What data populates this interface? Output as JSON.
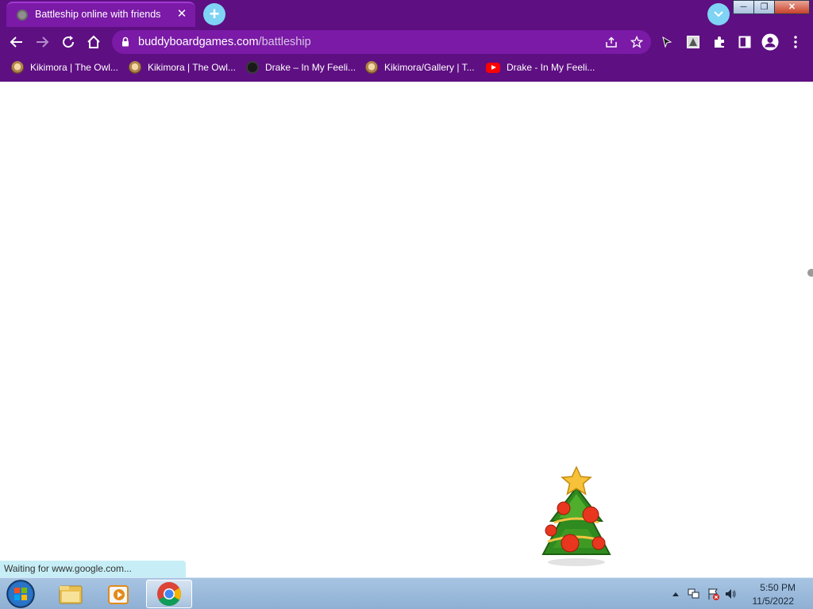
{
  "tab": {
    "title": "Battleship online with friends",
    "close_glyph": "✕"
  },
  "new_tab_glyph": "+",
  "window_controls": {
    "minimize": "─",
    "restore": "❐",
    "close": "✕"
  },
  "address_bar": {
    "domain": "buddyboardgames.com",
    "path": "/battleship"
  },
  "bookmarks": [
    {
      "label": "Kikimora | The Owl...",
      "icon": "owl-house-icon"
    },
    {
      "label": "Kikimora | The Owl...",
      "icon": "owl-house-icon"
    },
    {
      "label": "Drake – In My Feeli...",
      "icon": "drake-icon"
    },
    {
      "label": "Kikimora/Gallery | T...",
      "icon": "owl-house-icon"
    },
    {
      "label": "Drake - In My Feeli...",
      "icon": "youtube-icon"
    }
  ],
  "status_bar": {
    "text": "Waiting for www.google.com..."
  },
  "taskbar": {
    "apps": [
      {
        "name": "windows-explorer",
        "icon": "folder-icon"
      },
      {
        "name": "media-player",
        "icon": "media-player-icon"
      },
      {
        "name": "chrome",
        "icon": "chrome-icon",
        "active": true
      }
    ],
    "clock": {
      "time": "5:50 PM",
      "date": "11/5/2022"
    }
  },
  "colors": {
    "chrome_frame": "#5e0f82",
    "omnibox": "#7a1aa6",
    "accent_button": "#7fd3f5",
    "status_bubble": "#c7eef6"
  }
}
